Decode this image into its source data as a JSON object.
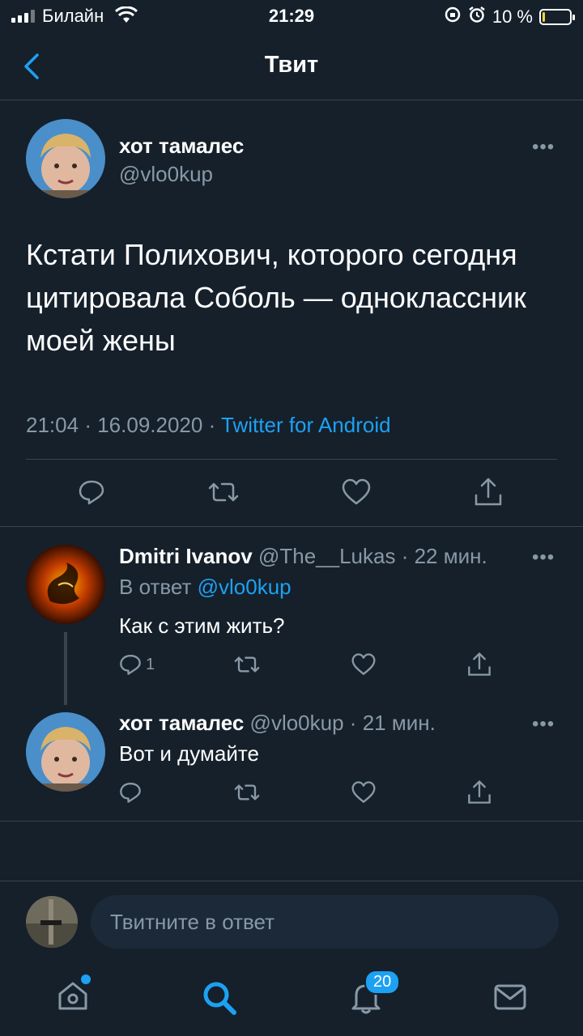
{
  "status_bar": {
    "carrier": "Билайн",
    "time": "21:29",
    "battery": "10 %",
    "battery_level": 0.1
  },
  "header": {
    "title": "Твит"
  },
  "main_tweet": {
    "author_name": "хот тамалес",
    "author_handle": "@vlo0kup",
    "text": "Кстати Полихович, которого сегодня цитировала Соболь — одноклассник моей жены",
    "time": "21:04",
    "date": "16.09.2020",
    "source": "Twitter for Android",
    "sep": "·"
  },
  "replies": [
    {
      "author_name": "Dmitri Ivanov",
      "author_handle": "@The__Lukas",
      "age": "22 мин.",
      "reply_prefix": "В ответ",
      "reply_to": "@vlo0kup",
      "text": "Как с этим жить?",
      "reply_count": "1",
      "sep": "·"
    },
    {
      "author_name": "хот тамалес",
      "author_handle": "@vlo0kup",
      "age": "21 мин.",
      "text": "Вот и думайте",
      "sep": "·"
    }
  ],
  "composer": {
    "placeholder": "Твитните в ответ"
  },
  "tabbar": {
    "notifications_badge": "20",
    "items": [
      "home-icon",
      "search-icon",
      "bell-icon",
      "mail-icon"
    ]
  },
  "colors": {
    "background": "#15202b",
    "accent": "#1da1f2",
    "muted": "#8899a6",
    "divider": "#38444d"
  }
}
